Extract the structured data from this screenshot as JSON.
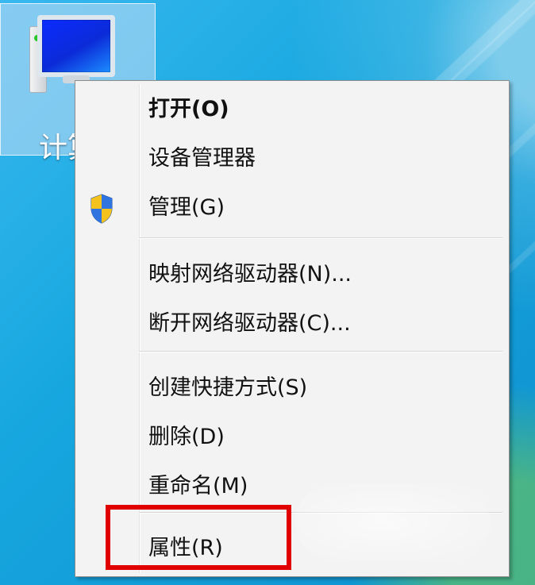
{
  "desktop": {
    "icon_label": "计算"
  },
  "menu": {
    "items": [
      {
        "label": "打开(O)",
        "bold": true
      },
      {
        "label": "设备管理器",
        "bold": false
      },
      {
        "label": "管理(G)",
        "bold": false,
        "icon": "shield-icon"
      },
      {
        "label": "映射网络驱动器(N)...",
        "bold": false
      },
      {
        "label": "断开网络驱动器(C)...",
        "bold": false
      },
      {
        "label": "创建快捷方式(S)",
        "bold": false
      },
      {
        "label": "删除(D)",
        "bold": false
      },
      {
        "label": "重命名(M)",
        "bold": false
      },
      {
        "label": "属性(R)",
        "bold": false
      }
    ]
  },
  "colors": {
    "highlight": "#e00000"
  }
}
